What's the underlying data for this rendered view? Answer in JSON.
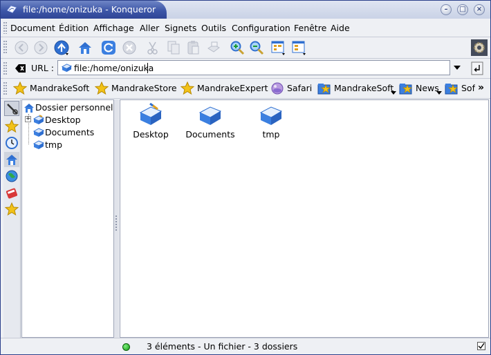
{
  "window": {
    "title": "file:/home/onizuka - Konqueror",
    "buttons": [
      "minimize",
      "maximize",
      "close"
    ]
  },
  "menu": {
    "items": [
      "Document",
      "Édition",
      "Affichage",
      "Aller",
      "Signets",
      "Outils",
      "Configuration",
      "Fenêtre",
      "Aide"
    ]
  },
  "toolbar": {
    "icons": [
      "back-icon",
      "forward-icon",
      "up-icon",
      "home-icon",
      "reload-icon",
      "stop-icon",
      "cut-icon",
      "copy-icon",
      "paste-icon",
      "print-icon",
      "zoom-in-icon",
      "zoom-out-icon",
      "icon-view-icon",
      "tree-view-icon",
      "konqueror-gear-icon"
    ]
  },
  "location": {
    "label": "URL :",
    "value": "file:/home/onizuka"
  },
  "bookmarks": {
    "items": [
      {
        "label": "MandrakeSoft",
        "icon": "star-icon"
      },
      {
        "label": "MandrakeStore",
        "icon": "star-icon"
      },
      {
        "label": "MandrakeExpert",
        "icon": "star-icon"
      },
      {
        "label": "Safari",
        "icon": "safari-icon"
      },
      {
        "label": "MandrakeSoft",
        "icon": "bookmark-folder-icon"
      },
      {
        "label": "News",
        "icon": "bookmark-folder-icon"
      },
      {
        "label": "Sof",
        "icon": "bookmark-folder-icon"
      }
    ],
    "overflow": "»"
  },
  "sidebar": {
    "tree": {
      "root": "Dossier personnel",
      "children": [
        "Desktop",
        "Documents",
        "tmp"
      ]
    }
  },
  "main": {
    "items": [
      "Desktop",
      "Documents",
      "tmp"
    ]
  },
  "status": {
    "text": "3 éléments - Un fichier - 3 dossiers"
  },
  "colors": {
    "title_active": "#3d56a8",
    "accent": "#2f6fd0",
    "star": "#f2c218"
  }
}
